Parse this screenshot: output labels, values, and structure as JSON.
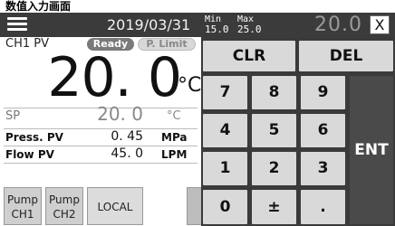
{
  "caption": "数值入力画面",
  "topbar": {
    "datetime": "2019/03/31",
    "min_label": "Min",
    "min_value": "15.0",
    "max_label": "Max",
    "max_value": "25.0",
    "input_value": "20.0",
    "close_label": "X"
  },
  "channel": {
    "label": "CH1 PV",
    "status_ready": "Ready",
    "status_limit": "P. Limit",
    "pv_value": "20. 0",
    "pv_unit": "°C"
  },
  "setpoint": {
    "label": "SP",
    "value": "20. 0",
    "unit": "°C"
  },
  "readings": [
    {
      "label": "Press. PV",
      "value": "0. 45",
      "unit": "MPa"
    },
    {
      "label": "Flow PV",
      "value": "45. 0",
      "unit": "LPM"
    }
  ],
  "bottom_buttons": {
    "pump_ch1_line1": "Pump",
    "pump_ch1_line2": "CH1",
    "pump_ch2_line1": "Pump",
    "pump_ch2_line2": "CH2",
    "local": "LOCAL"
  },
  "keypad": {
    "clr": "CLR",
    "del": "DEL",
    "k7": "7",
    "k8": "8",
    "k9": "9",
    "k4": "4",
    "k5": "5",
    "k6": "6",
    "k1": "1",
    "k2": "2",
    "k3": "3",
    "k0": "0",
    "kpm": "±",
    "kdot": ".",
    "ent": "ENT"
  }
}
